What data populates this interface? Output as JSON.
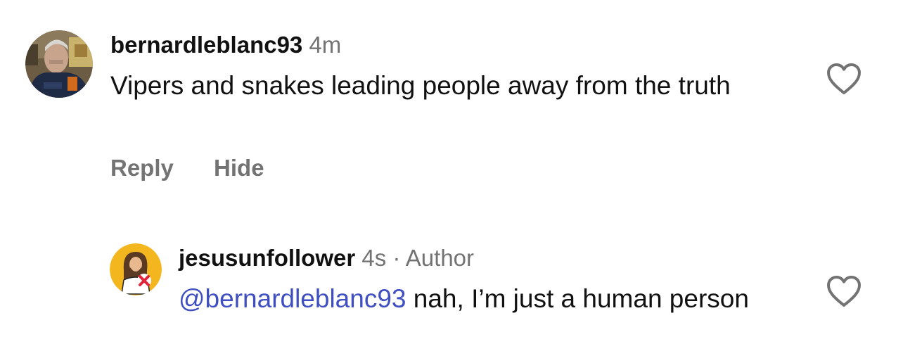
{
  "comments": [
    {
      "username": "bernardleblanc93",
      "time": "4m",
      "text": "Vipers and snakes leading people away from the truth",
      "actions": {
        "reply": "Reply",
        "hide": "Hide"
      },
      "like_icon": "heart-outline-icon"
    },
    {
      "username": "jesusunfollower",
      "time": "4s",
      "separator": "·",
      "badge": "Author",
      "mention": "@bernardleblanc93",
      "text": " nah, I’m just a human person",
      "like_icon": "heart-outline-icon"
    }
  ],
  "colors": {
    "meta_gray": "#737373",
    "mention_blue": "#3f4fc2",
    "avatar_yellow": "#f3b61f",
    "x_red": "#e0243a"
  }
}
